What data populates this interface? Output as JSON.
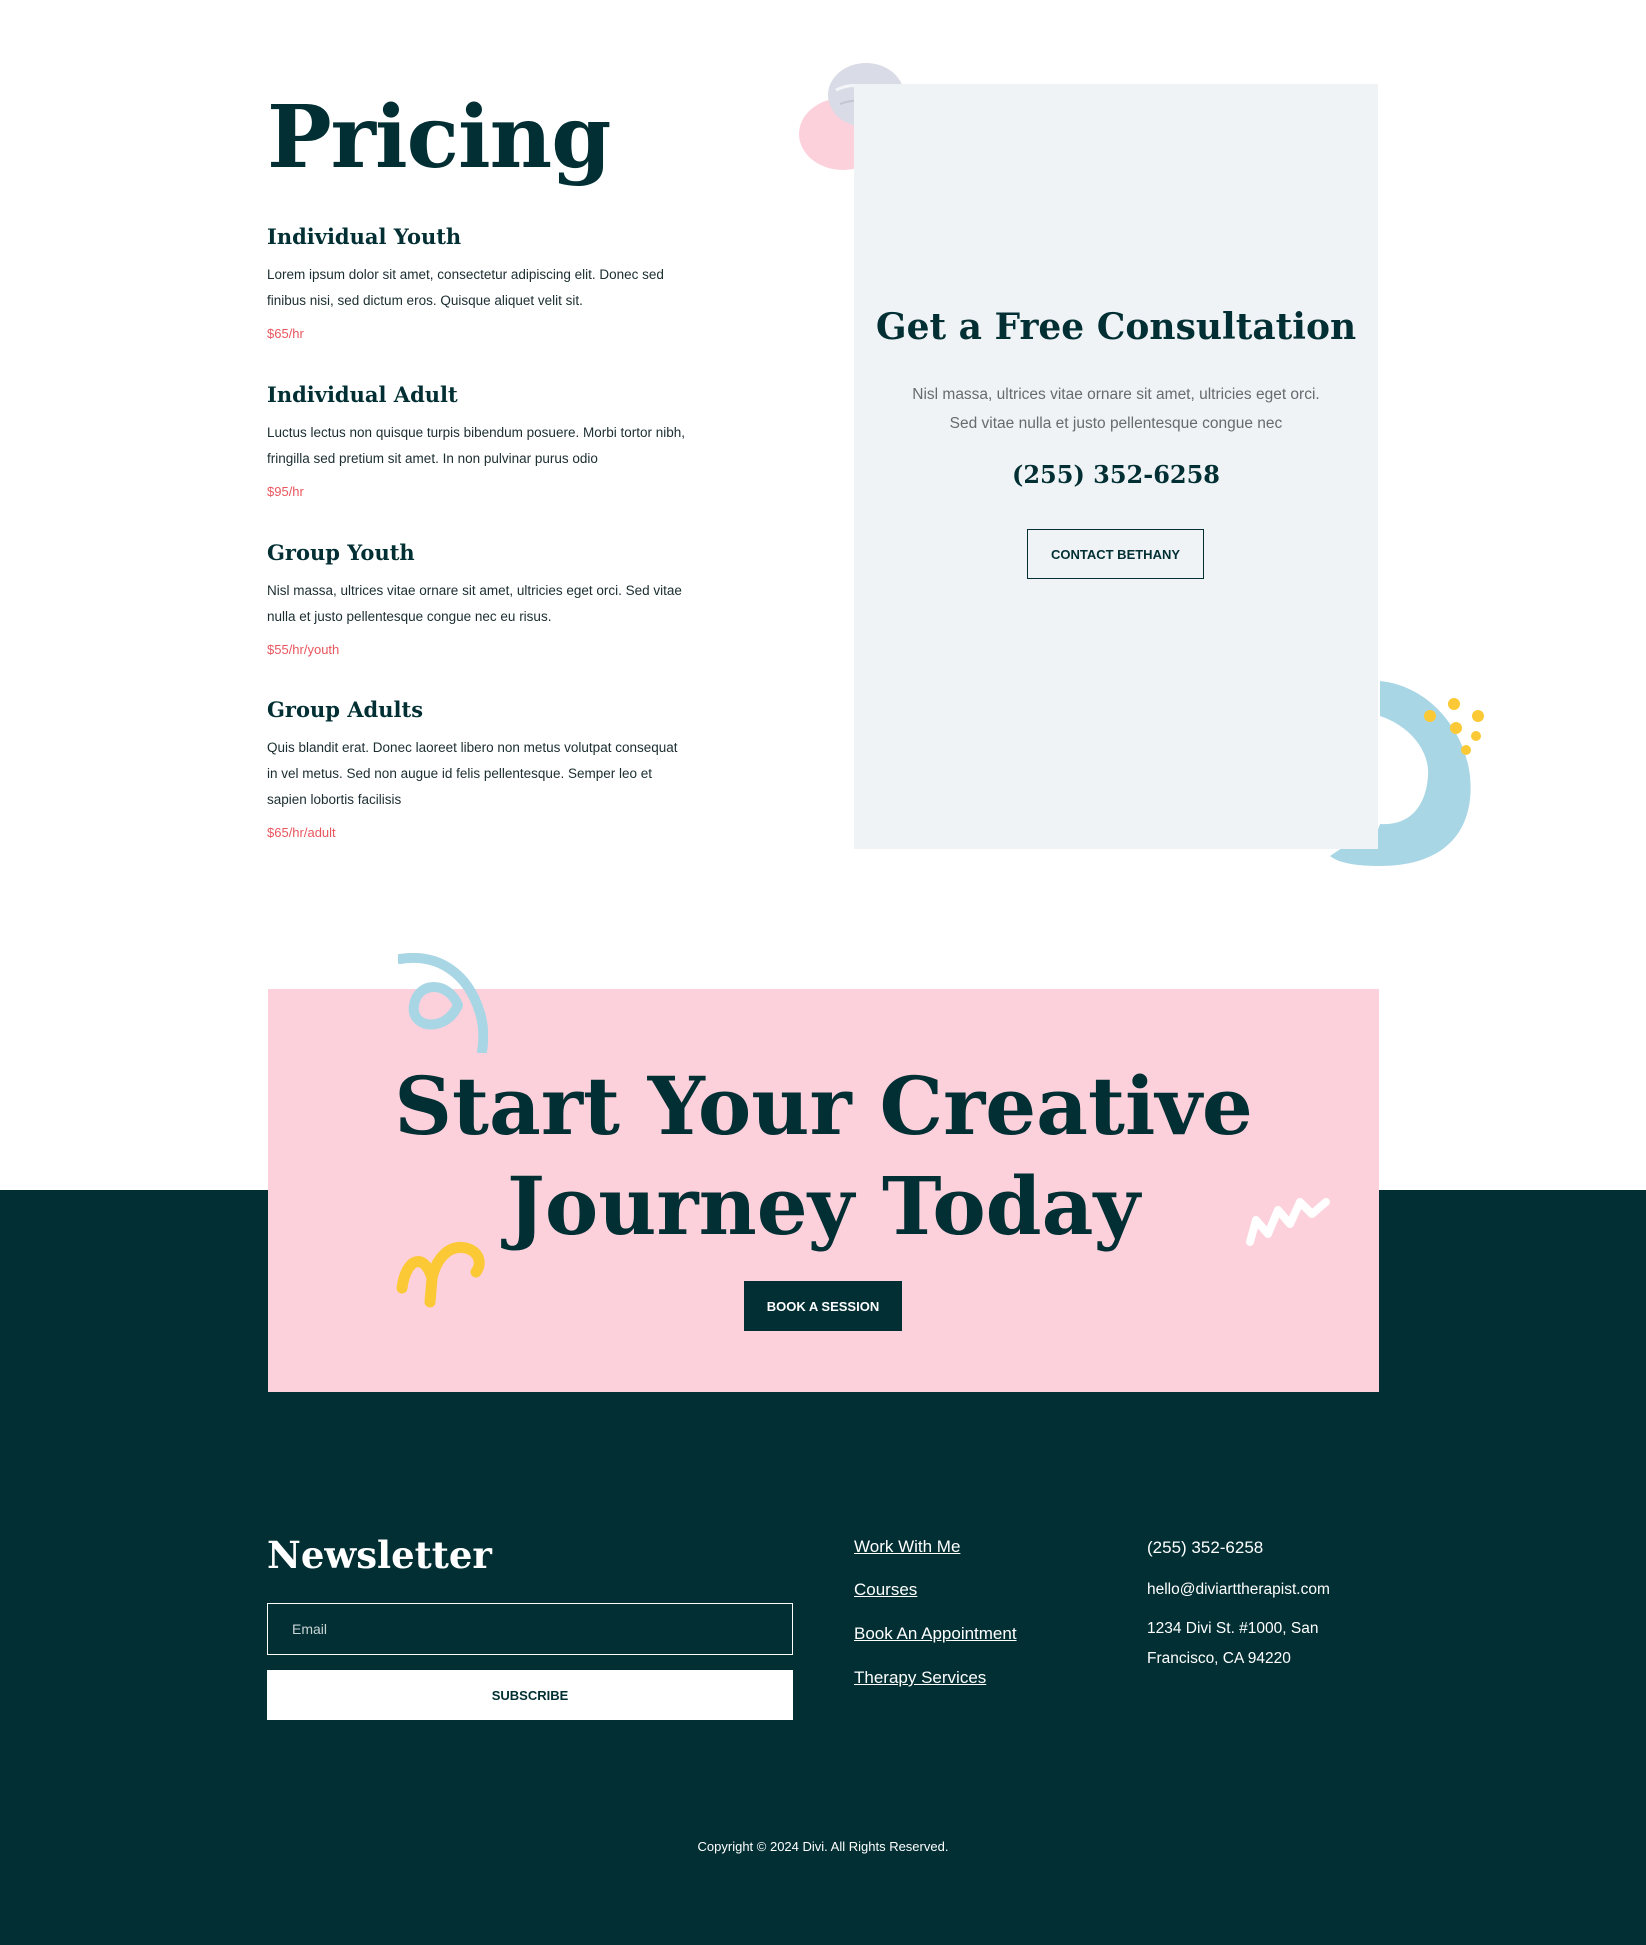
{
  "pricing": {
    "title": "Pricing",
    "plans": [
      {
        "name": "Individual Youth",
        "description": "Lorem ipsum dolor sit amet, consectetur adipiscing elit. Donec sed finibus nisi, sed dictum eros. Quisque aliquet velit sit.",
        "price": "$65/hr"
      },
      {
        "name": "Individual Adult",
        "description": "Luctus lectus non quisque turpis bibendum posuere. Morbi tortor nibh, fringilla sed pretium sit amet. In non pulvinar purus odio",
        "price": "$95/hr"
      },
      {
        "name": "Group Youth",
        "description": "Nisl massa, ultrices vitae ornare sit amet, ultricies eget orci. Sed vitae nulla et justo pellentesque congue nec eu risus.",
        "price": "$55/hr/youth"
      },
      {
        "name": "Group Adults",
        "description": "Quis blandit erat. Donec laoreet libero non metus volutpat consequat in vel metus. Sed non augue id felis pellentesque. Semper leo et sapien lobortis facilisis",
        "price": "$65/hr/adult"
      }
    ]
  },
  "consultation": {
    "title": "Get a Free Consultation",
    "text": "Nisl massa, ultrices vitae ornare sit amet, ultricies eget orci. Sed vitae nulla et justo pellentesque congue nec",
    "phone": "(255) 352-6258",
    "button_label": "CONTACT BETHANY"
  },
  "cta": {
    "title_line1": "Start Your Creative",
    "title_line2": "Journey Today",
    "button_label": "BOOK A SESSION"
  },
  "footer": {
    "newsletter_title": "Newsletter",
    "email_placeholder": "Email",
    "subscribe_label": "SUBSCRIBE",
    "links": [
      "Work With Me",
      "Courses",
      "Book An Appointment",
      "Therapy Services"
    ],
    "phone": "(255) 352-6258",
    "email": "hello@diviarttherapist.com",
    "address_line1": "1234 Divi St. #1000, San",
    "address_line2": "Francisco, CA 94220",
    "copyright": "Copyright © 2024 Divi. All Rights Reserved."
  },
  "colors": {
    "dark_teal": "#022f33",
    "accent_red": "#e8565e",
    "pink": "#fcd1dc",
    "light_gray": "#f0f3f6",
    "light_blue": "#a9d6e5",
    "yellow": "#fbc935"
  },
  "icons": [
    "pink-blob-decoration",
    "marble-blob-decoration",
    "blue-ring-decoration",
    "yellow-dots-decoration",
    "blue-loop-decoration",
    "yellow-squiggle-decoration",
    "white-zigzag-decoration"
  ]
}
